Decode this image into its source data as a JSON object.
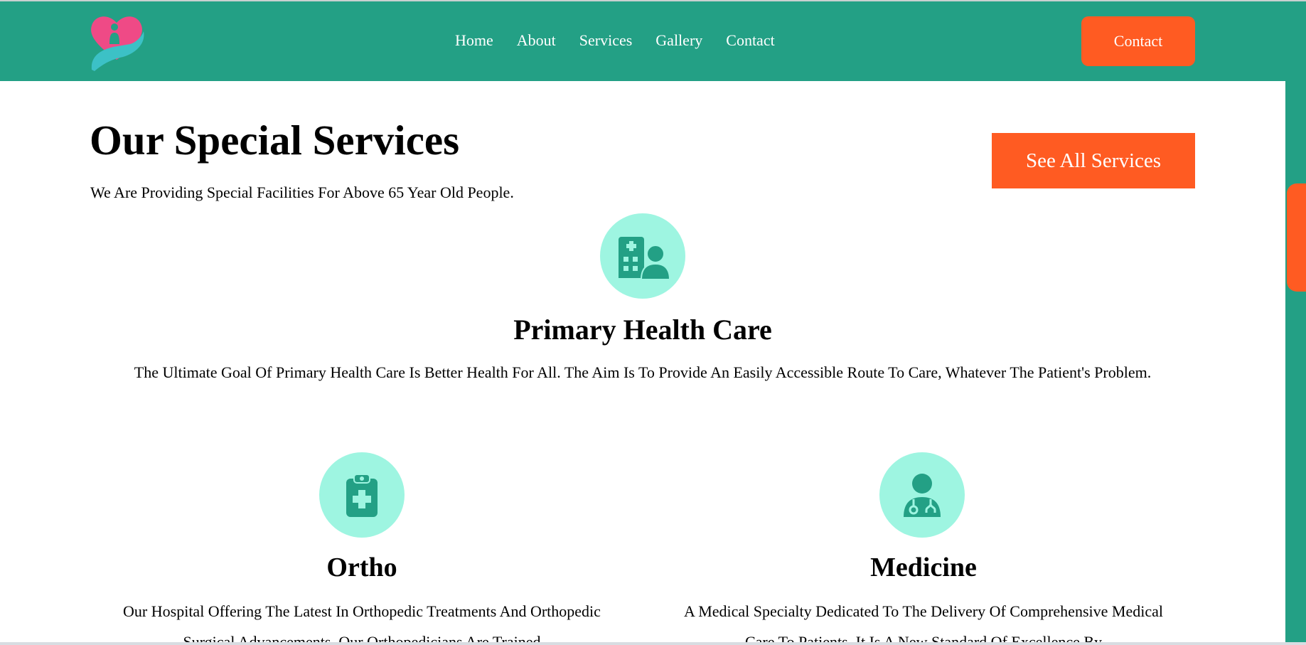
{
  "header": {
    "nav": [
      {
        "label": "Home"
      },
      {
        "label": "About"
      },
      {
        "label": "Services"
      },
      {
        "label": "Gallery"
      },
      {
        "label": "Contact"
      }
    ],
    "contact_button": "Contact",
    "logo_icon": "heart-in-hand-logo"
  },
  "services": {
    "title": "Our Special Services",
    "subtitle": "We Are Providing Special Facilities For Above 65 Year Old People.",
    "see_all_button": "See All Services",
    "cards": [
      {
        "icon": "hospital-user-icon",
        "title": "Primary Health Care",
        "text": "The Ultimate Goal Of Primary Health Care Is Better Health For All. The Aim Is To Provide An Easily Accessible Route To Care, Whatever The Patient's Problem."
      },
      {
        "icon": "clipboard-medical-icon",
        "title": "Ortho",
        "text": "Our Hospital Offering The Latest In Orthopedic Treatments And Orthopedic Surgical Advancements. Our Orthopedicians Are Trained"
      },
      {
        "icon": "doctor-icon",
        "title": "Medicine",
        "text": "A Medical Specialty Dedicated To The Delivery Of Comprehensive Medical Care To Patients. It Is A New Standard Of Excellence By"
      }
    ]
  },
  "colors": {
    "brand_teal": "#23a085",
    "accent_orange": "#ff5b22",
    "icon_bg": "#9ef5e1",
    "icon_fg": "#23a085"
  }
}
